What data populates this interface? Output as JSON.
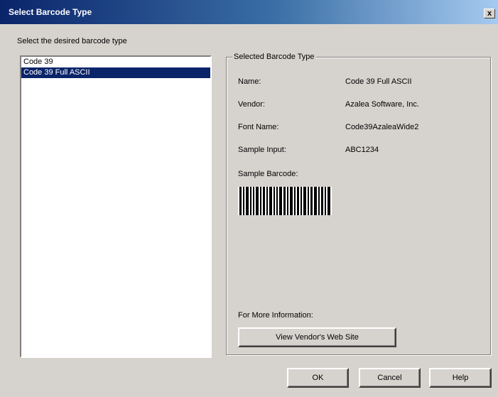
{
  "window": {
    "title": "Select Barcode Type",
    "close_glyph": "x"
  },
  "prompt": "Select the desired barcode type",
  "barcode_list": {
    "items": [
      "Code 39",
      "Code 39 Full ASCII"
    ],
    "selected_index": 1
  },
  "details": {
    "group_title": "Selected Barcode Type",
    "name_label": "Name:",
    "name_value": "Code 39 Full ASCII",
    "vendor_label": "Vendor:",
    "vendor_value": "Azalea Software, Inc.",
    "font_label": "Font Name:",
    "font_value": "Code39AzaleaWide2",
    "sample_input_label": "Sample Input:",
    "sample_input_value": "ABC1234",
    "sample_barcode_label": "Sample Barcode:",
    "more_info_label": "For More Information:",
    "vendor_button": "View Vendor's Web Site"
  },
  "buttons": {
    "ok": "OK",
    "cancel": "Cancel",
    "help": "Help"
  },
  "colors": {
    "selection": "#0a246a",
    "face": "#d6d3ce",
    "title_start": "#0a246a",
    "title_end": "#a6caf0"
  }
}
